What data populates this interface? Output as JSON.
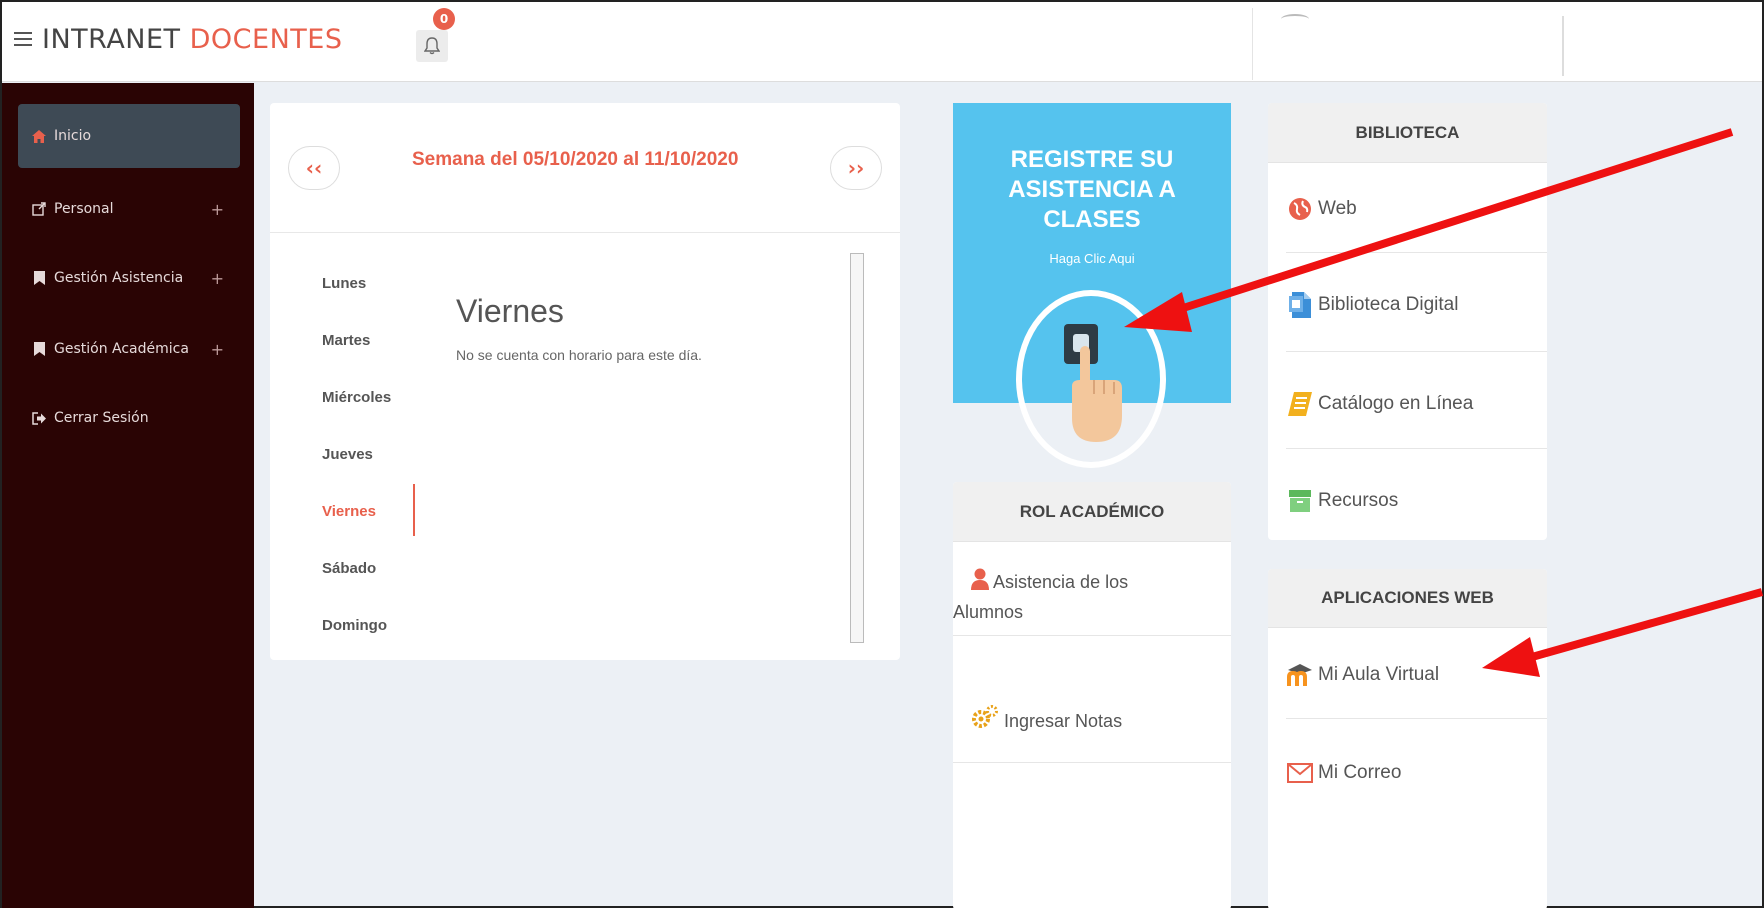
{
  "header": {
    "brand_main": "INTRANET ",
    "brand_accent": "DOCENTES",
    "notification_count": "0"
  },
  "sidebar": {
    "items": [
      {
        "label": "Inicio",
        "icon": "home-icon",
        "expandable": false
      },
      {
        "label": "Personal",
        "icon": "external-link-icon",
        "expandable": true
      },
      {
        "label": "Gestión Asistencia",
        "icon": "bookmark-icon",
        "expandable": true
      },
      {
        "label": "Gestión Académica",
        "icon": "bookmark-icon",
        "expandable": true
      },
      {
        "label": "Cerrar Sesión",
        "icon": "sign-out-icon",
        "expandable": false
      }
    ],
    "plus_symbol": "+"
  },
  "calendar": {
    "prev_label": "‹‹",
    "next_label": "››",
    "week_title": "Semana del 05/10/2020 al 11/10/2020",
    "days": [
      "Lunes",
      "Martes",
      "Miércoles",
      "Jueves",
      "Viernes",
      "Sábado",
      "Domingo"
    ],
    "selected_day": "Viernes",
    "selected_title": "Viernes",
    "selected_message": "No se cuenta con horario para este día."
  },
  "register": {
    "title_line1": "REGISTRE SU",
    "title_line2": "ASISTENCIA A",
    "title_line3": "CLASES",
    "subtitle": "Haga Clic Aqui",
    "color": "#55c3ee"
  },
  "rol_academico": {
    "title": "ROL ACADÉMICO",
    "items": [
      {
        "label_line1": "Asistencia de los",
        "label_line2": "Alumnos",
        "icon": "user-icon"
      },
      {
        "label": "Ingresar Notas",
        "icon": "gears-icon"
      }
    ]
  },
  "biblioteca": {
    "title": "BIBLIOTECA",
    "items": [
      {
        "label": "Web",
        "icon": "globe-icon"
      },
      {
        "label": "Biblioteca Digital",
        "icon": "document-icon"
      },
      {
        "label": "Catálogo en Línea",
        "icon": "book-icon"
      },
      {
        "label": "Recursos",
        "icon": "archive-icon"
      }
    ]
  },
  "aplicaciones_web": {
    "title": "APLICACIONES WEB",
    "items": [
      {
        "label": "Mi Aula Virtual",
        "icon": "moodle-icon"
      },
      {
        "label": "Mi Correo",
        "icon": "envelope-icon"
      }
    ]
  },
  "colors": {
    "accent": "#e8604c",
    "sidebar_bg": "#2a0404",
    "sidebar_active": "#3e4a55",
    "arrow": "#ee1111"
  }
}
